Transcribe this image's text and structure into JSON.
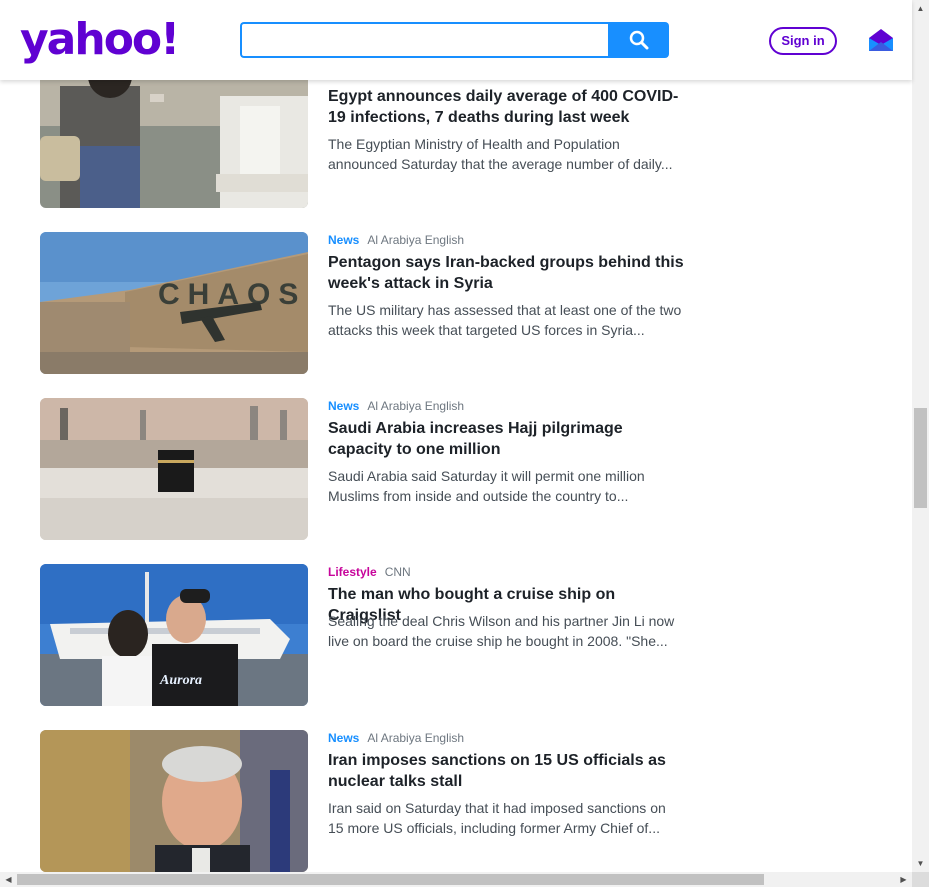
{
  "header": {
    "logo": "yahoo!",
    "search_value": "",
    "signin_label": "Sign in",
    "icons": {
      "search": "search-icon",
      "mail": "mail-icon"
    },
    "colors": {
      "brand": "#6001d2",
      "accent": "#188fff"
    }
  },
  "articles": [
    {
      "category": "",
      "source": "",
      "headline": "Egypt announces daily average of 400 COVID-19 infections, 7 deaths during last week",
      "summary": "The Egyptian Ministry of Health and Population announced Saturday that the average number of daily..."
    },
    {
      "category": "News",
      "source": "Al Arabiya English",
      "headline": "Pentagon says Iran-backed groups behind this week's attack in Syria",
      "summary": "The US military has assessed that at least one of the two attacks this week that targeted US forces in Syria..."
    },
    {
      "category": "News",
      "source": "Al Arabiya English",
      "headline": "Saudi Arabia increases Hajj pilgrimage capacity to one million",
      "summary": "Saudi Arabia said Saturday it will permit one million Muslims from inside and outside the country to..."
    },
    {
      "category": "Lifestyle",
      "source": "CNN",
      "headline": "The man who bought a cruise ship on Craigslist",
      "summary": "Sealing the deal Chris Wilson and his partner Jin Li now live on board the cruise ship he bought in 2008. \"She..."
    },
    {
      "category": "News",
      "source": "Al Arabiya English",
      "headline": "Iran imposes sanctions on 15 US officials as nuclear talks stall",
      "summary": "Iran said on Saturday that it had imposed sanctions on 15 more US officials, including former Army Chief of..."
    }
  ],
  "images": {
    "chaos_wall_text": "CHAOS",
    "aurora_shirt_text": "Aurora"
  },
  "category_colors": {
    "News": "#188fff",
    "Lifestyle": "#c7059b"
  }
}
